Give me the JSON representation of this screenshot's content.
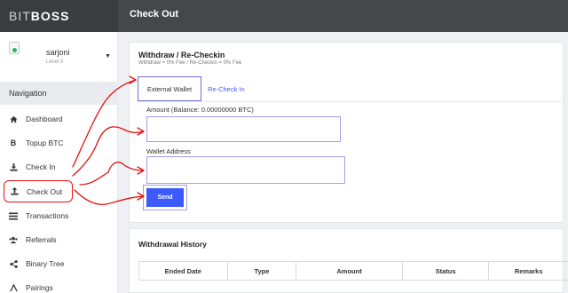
{
  "brand": {
    "part1": "BIT",
    "part2": "BOSS"
  },
  "header": {
    "title": "Check Out"
  },
  "user": {
    "name": "sarjoni",
    "level": "Level 0"
  },
  "sidebar": {
    "heading": "Navigation",
    "items": [
      {
        "label": "Dashboard",
        "icon": "home-icon"
      },
      {
        "label": "Topup BTC",
        "icon": "bitcoin-icon"
      },
      {
        "label": "Check In",
        "icon": "download-icon"
      },
      {
        "label": "Check Out",
        "icon": "upload-icon",
        "active": true
      },
      {
        "label": "Transactions",
        "icon": "list-icon"
      },
      {
        "label": "Referrals",
        "icon": "users-icon"
      },
      {
        "label": "Binary Tree",
        "icon": "share-icon"
      },
      {
        "label": "Pairings",
        "icon": "pairings-icon"
      }
    ]
  },
  "withdraw": {
    "title": "Withdraw / Re-Checkin",
    "subtitle": "Withdraw = 0% Fee / Re-Checkin = 0% Fee",
    "tabs": {
      "external": "External Wallet",
      "recheckin": "Re-Check In"
    },
    "amount_label": "Amount (Balance: 0.00000000 BTC)",
    "amount_value": "",
    "wallet_label": "Wallet Address",
    "wallet_value": "",
    "send_label": "Send"
  },
  "history": {
    "title": "Withdrawal History",
    "columns": [
      "Ended Date",
      "Type",
      "Amount",
      "Status",
      "Remarks"
    ]
  },
  "colors": {
    "accent": "#3d5afe",
    "annotation": "#e11111",
    "highlight": "#9f9fe6",
    "topbar": "#45474b"
  }
}
